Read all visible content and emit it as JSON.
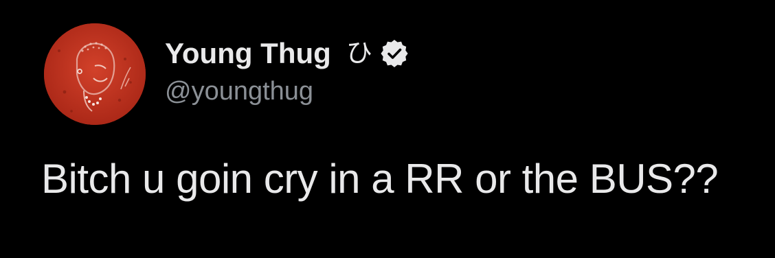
{
  "tweet": {
    "author": {
      "display_name": "Young Thug",
      "name_glyph": "ひ",
      "handle": "@youngthug",
      "verified": true,
      "avatar_icon": "avatar-illustration",
      "avatar_color": "#c3301d"
    },
    "text": "Bitch u goin cry in a RR or the BUS??"
  },
  "colors": {
    "background": "#000000",
    "primary_text": "#e9e9ea",
    "secondary_text": "#8b9096"
  }
}
